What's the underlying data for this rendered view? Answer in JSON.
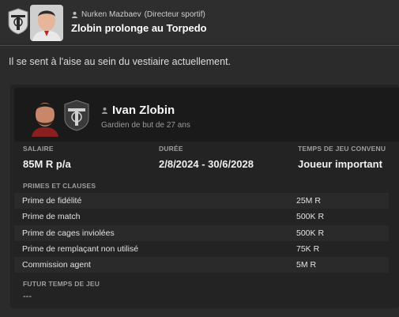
{
  "header": {
    "sender_name": "Nurken Mazbaev",
    "sender_role": "(Directeur sportif)",
    "title": "Zlobin prolonge au Torpedo"
  },
  "message": {
    "body": "Il se sent à l'aise au sein du vestiaire actuellement."
  },
  "player": {
    "name": "Ivan Zlobin",
    "subtitle": "Gardien de but de 27 ans"
  },
  "contract": {
    "salary_label": "SALAIRE",
    "salary_value": "85M R p/a",
    "duration_label": "DURÉE",
    "duration_value": "2/8/2024 - 30/6/2028",
    "playtime_label": "TEMPS DE JEU CONVENU",
    "playtime_value": "Joueur important"
  },
  "clauses": {
    "label": "PRIMES ET CLAUSES",
    "items": [
      {
        "name": "Prime de fidélité",
        "value": "25M R"
      },
      {
        "name": "Prime de match",
        "value": "500K R"
      },
      {
        "name": "Prime de cages inviolées",
        "value": "500K R"
      },
      {
        "name": "Prime de remplaçant non utilisé",
        "value": "75K R"
      },
      {
        "name": "Commission agent",
        "value": "5M R"
      }
    ]
  },
  "future": {
    "label": "FUTUR TEMPS DE JEU",
    "value": "---"
  },
  "colors": {
    "background": "#2b2b2b",
    "card": "#232323",
    "card_header": "#1a1a1a"
  },
  "icons": [
    "torpedo-club-badge",
    "user-icon"
  ]
}
